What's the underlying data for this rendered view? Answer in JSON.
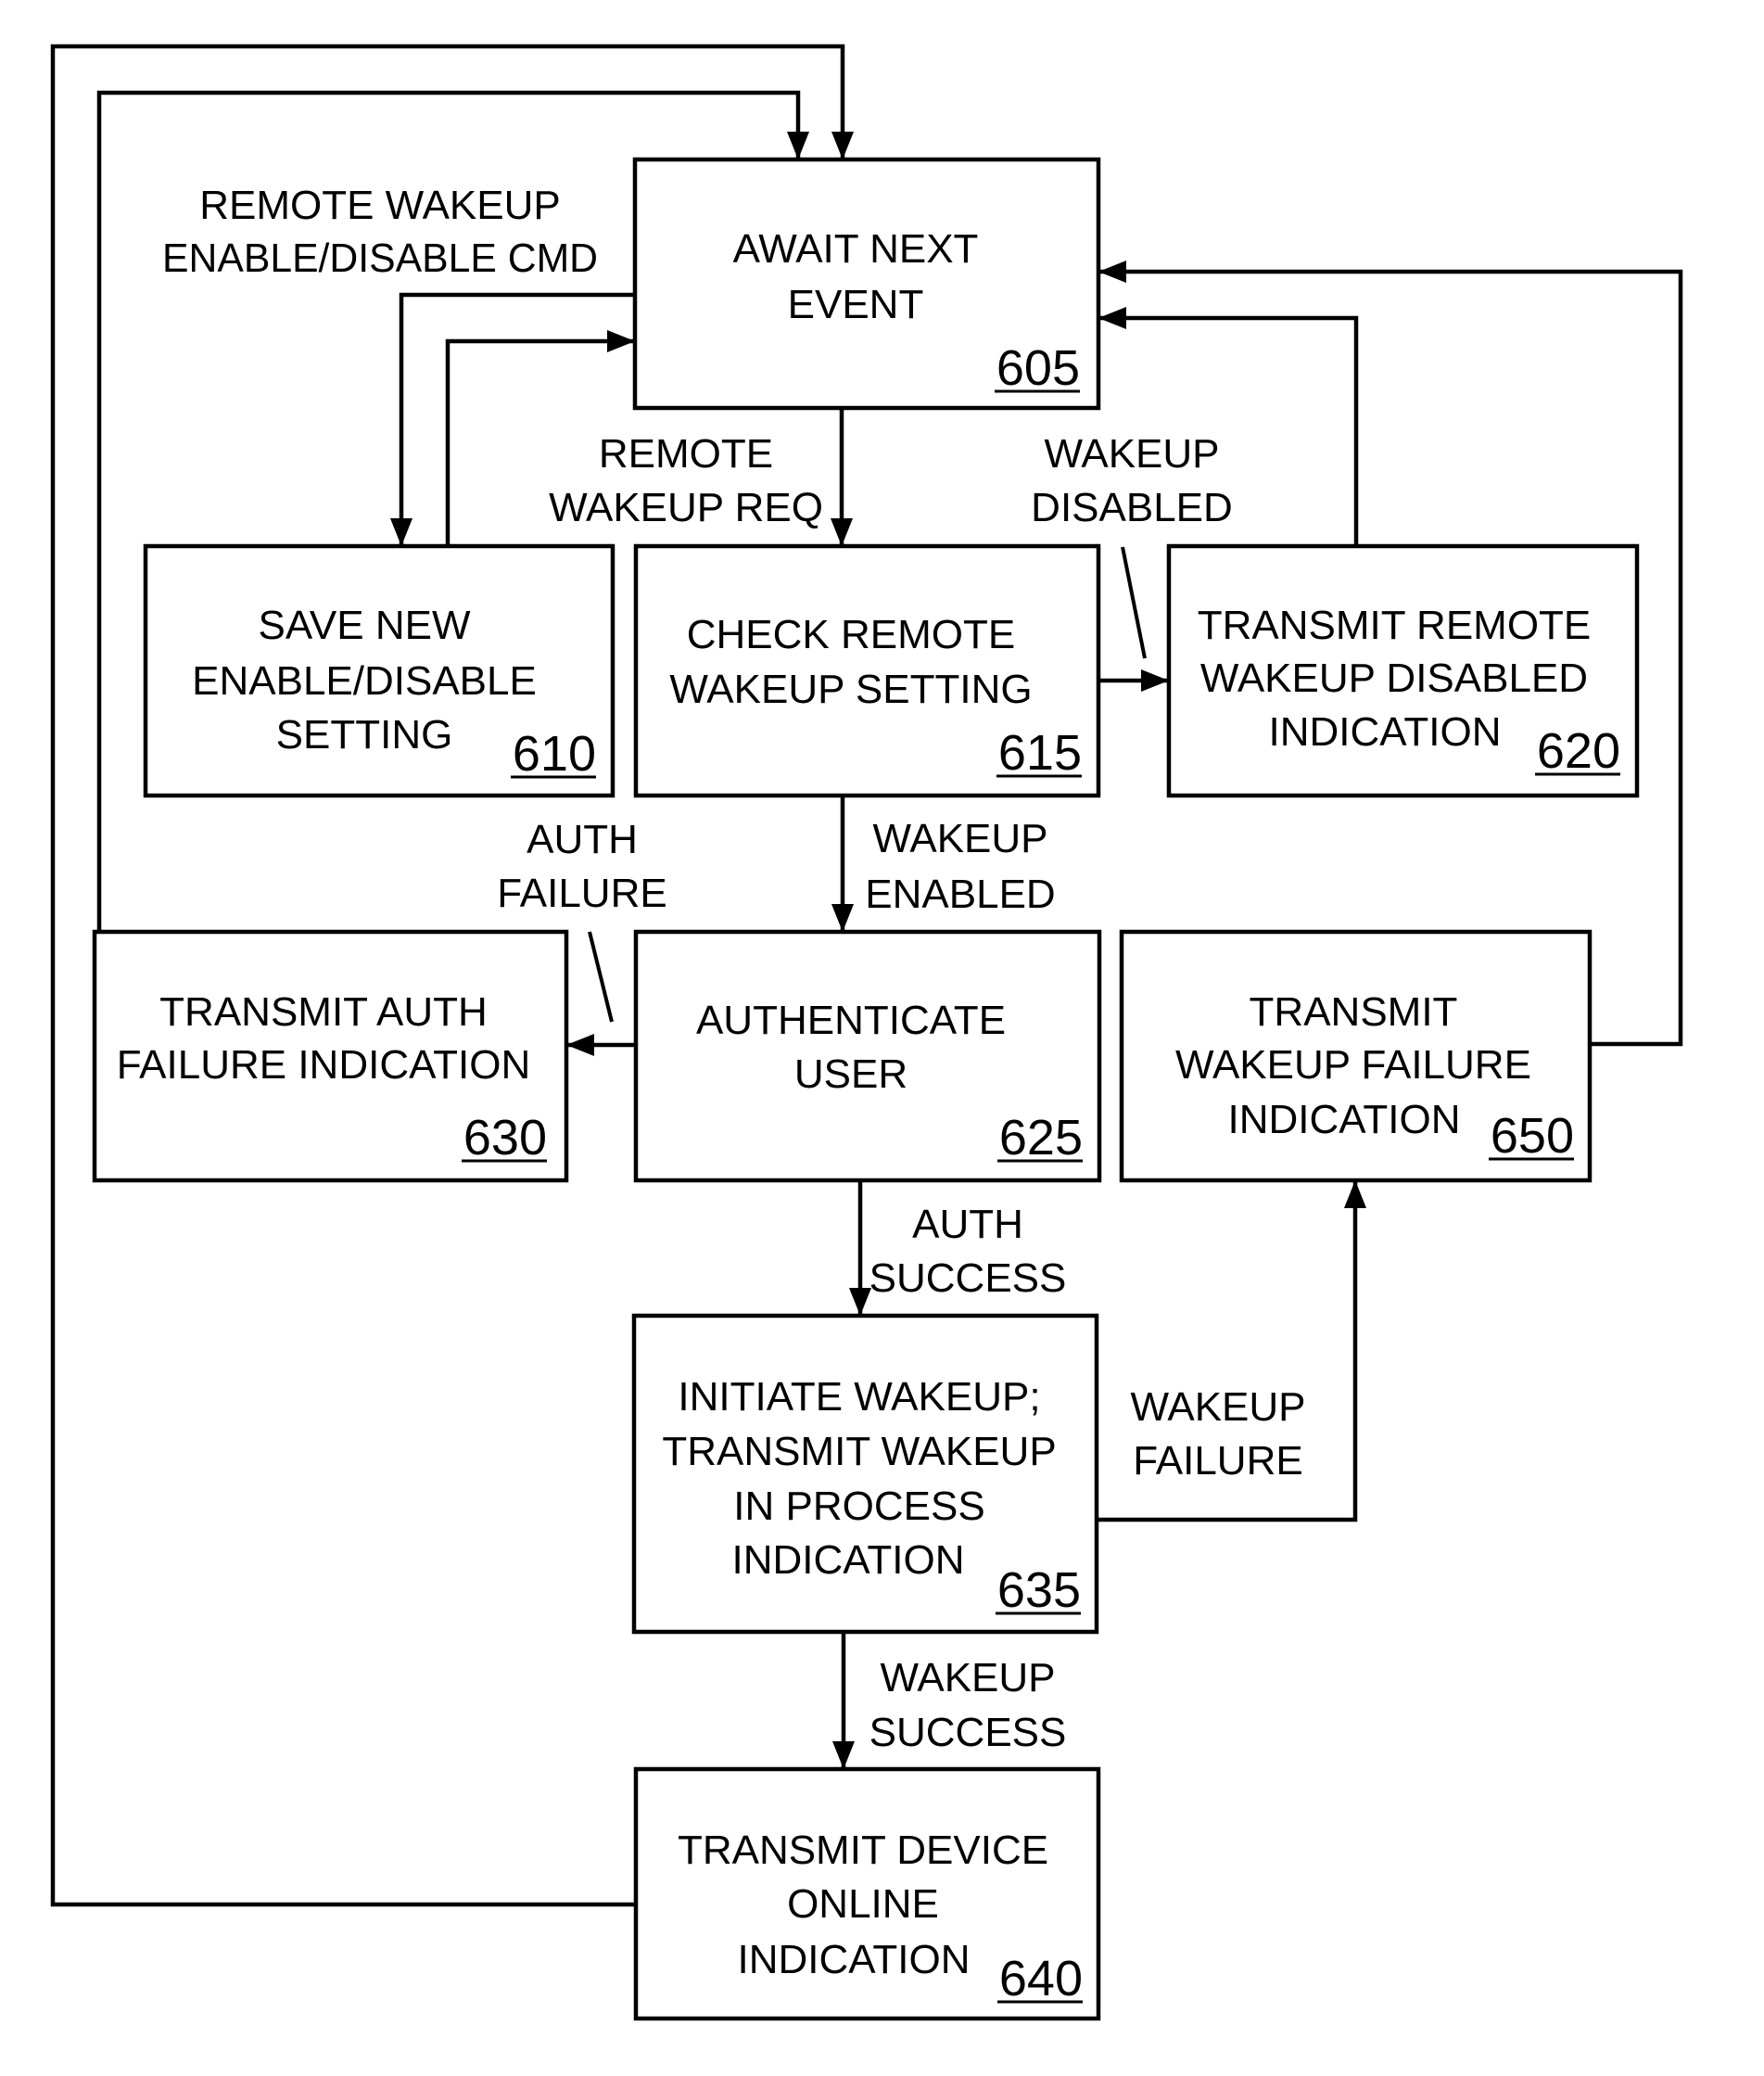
{
  "figure": {
    "type": "flowchart",
    "colors": {
      "line": "#000000",
      "background": "#ffffff"
    }
  },
  "nodes": [
    {
      "id": "605",
      "ref": "605",
      "lines": [
        "AWAIT NEXT",
        "EVENT"
      ]
    },
    {
      "id": "610",
      "ref": "610",
      "lines": [
        "SAVE NEW",
        "ENABLE/DISABLE",
        "SETTING"
      ]
    },
    {
      "id": "615",
      "ref": "615",
      "lines": [
        "CHECK REMOTE",
        "WAKEUP SETTING"
      ]
    },
    {
      "id": "620",
      "ref": "620",
      "lines": [
        "TRANSMIT REMOTE",
        "WAKEUP DISABLED",
        "INDICATION"
      ]
    },
    {
      "id": "625",
      "ref": "625",
      "lines": [
        "AUTHENTICATE",
        "USER"
      ]
    },
    {
      "id": "630",
      "ref": "630",
      "lines": [
        "TRANSMIT AUTH",
        "FAILURE INDICATION"
      ]
    },
    {
      "id": "635",
      "ref": "635",
      "lines": [
        "INITIATE WAKEUP;",
        "TRANSMIT WAKEUP",
        "IN PROCESS",
        "INDICATION"
      ]
    },
    {
      "id": "640",
      "ref": "640",
      "lines": [
        "TRANSMIT DEVICE",
        "ONLINE",
        "INDICATION"
      ]
    },
    {
      "id": "650",
      "ref": "650",
      "lines": [
        "TRANSMIT",
        "WAKEUP FAILURE",
        "INDICATION"
      ]
    }
  ],
  "edge_labels": [
    {
      "id": "enable-disable-cmd",
      "from": "605",
      "to": "610",
      "lines": [
        "REMOTE WAKEUP",
        "ENABLE/DISABLE CMD"
      ]
    },
    {
      "id": "remote-wakeup-req",
      "from": "605",
      "to": "615",
      "lines": [
        "REMOTE",
        "WAKEUP REQ"
      ]
    },
    {
      "id": "wakeup-disabled",
      "from": "615",
      "to": "620",
      "lines": [
        "WAKEUP",
        "DISABLED"
      ]
    },
    {
      "id": "wakeup-enabled",
      "from": "615",
      "to": "625",
      "lines": [
        "WAKEUP",
        "ENABLED"
      ]
    },
    {
      "id": "auth-failure",
      "from": "625",
      "to": "630",
      "lines": [
        "AUTH",
        "FAILURE"
      ]
    },
    {
      "id": "auth-success",
      "from": "625",
      "to": "635",
      "lines": [
        "AUTH",
        "SUCCESS"
      ]
    },
    {
      "id": "wakeup-failure",
      "from": "635",
      "to": "650",
      "lines": [
        "WAKEUP",
        "FAILURE"
      ]
    },
    {
      "id": "wakeup-success",
      "from": "635",
      "to": "640",
      "lines": [
        "WAKEUP",
        "SUCCESS"
      ]
    }
  ],
  "edges": [
    {
      "id": "605-to-610",
      "from": "605",
      "to": "610"
    },
    {
      "id": "610-to-605",
      "from": "610",
      "to": "605"
    },
    {
      "id": "605-to-615",
      "from": "605",
      "to": "615"
    },
    {
      "id": "615-to-620",
      "from": "615",
      "to": "620"
    },
    {
      "id": "620-to-605",
      "from": "620",
      "to": "605"
    },
    {
      "id": "615-to-625",
      "from": "615",
      "to": "625"
    },
    {
      "id": "625-to-630",
      "from": "625",
      "to": "630"
    },
    {
      "id": "630-to-605",
      "from": "630",
      "to": "605"
    },
    {
      "id": "625-to-635",
      "from": "625",
      "to": "635"
    },
    {
      "id": "635-to-650",
      "from": "635",
      "to": "650"
    },
    {
      "id": "650-to-605",
      "from": "650",
      "to": "605"
    },
    {
      "id": "635-to-640",
      "from": "635",
      "to": "640"
    },
    {
      "id": "640-to-605",
      "from": "640",
      "to": "605"
    }
  ]
}
